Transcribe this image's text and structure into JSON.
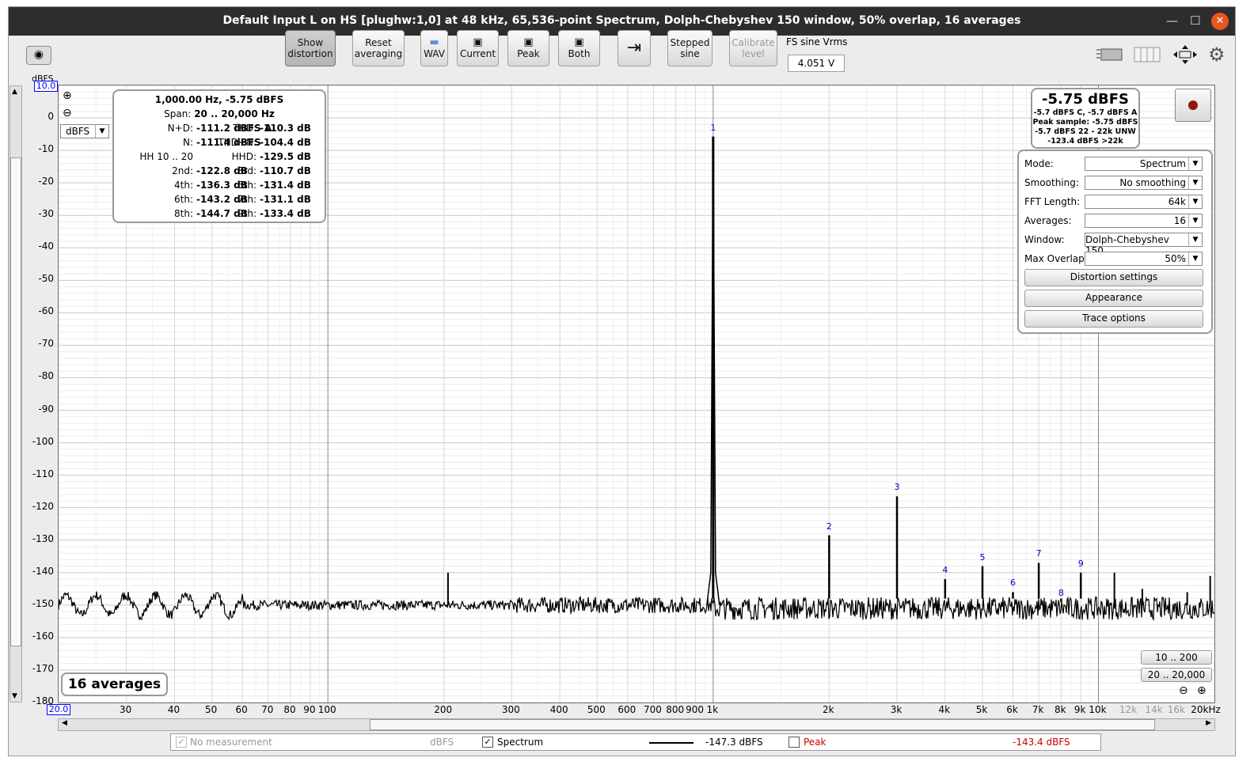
{
  "window": {
    "title": "Default Input L on HS [plughw:1,0] at 48 kHz, 65,536-point Spectrum, Dolph-Chebyshev 150 window, 50% overlap, 16 averages"
  },
  "toolbar": {
    "show_distortion": [
      "Show",
      "distortion"
    ],
    "reset_averaging": [
      "Reset",
      "averaging"
    ],
    "wav": "WAV",
    "current": "Current",
    "peak": "Peak",
    "both": "Both",
    "stepped_sine": [
      "Stepped",
      "sine"
    ],
    "calibrate_level": [
      "Calibrate",
      "level"
    ],
    "fs_label": "FS sine Vrms",
    "fs_value": "4.051 V"
  },
  "axis": {
    "unit": "dBFS",
    "ymax": "10.0",
    "xmin": "20.0",
    "y_ticks": [
      "0",
      "-10",
      "-20",
      "-30",
      "-40",
      "-50",
      "-60",
      "-70",
      "-80",
      "-90",
      "-100",
      "-110",
      "-120",
      "-130",
      "-140",
      "-150",
      "-160",
      "-170",
      "-180"
    ],
    "x_ticks": [
      "30",
      "40",
      "50",
      "60",
      "70",
      "80",
      "90",
      "100",
      "200",
      "300",
      "400",
      "500",
      "600",
      "700",
      "800",
      "900",
      "1k",
      "2k",
      "3k",
      "4k",
      "5k",
      "6k",
      "7k",
      "8k",
      "9k",
      "10k",
      "12k",
      "14k",
      "16k",
      "20kHz"
    ]
  },
  "unit_select": "dBFS",
  "distortion_panel": {
    "header": "1,000.00 Hz, -5.75 dBFS",
    "span_label": "Span:",
    "span_value": "20 .. 20,000 Hz",
    "rows": [
      {
        "l": "N+D:",
        "lv": "-111.2 dBFS A",
        "r": "THD:",
        "rv": "-110.3 dB"
      },
      {
        "l": "N:",
        "lv": "-111.4 dBFS",
        "r": "THD+N:",
        "rv": "-104.4 dB"
      },
      {
        "l": "HH 10 .. 20",
        "lv": "",
        "r": "HHD:",
        "rv": "-129.5 dB"
      },
      {
        "l": "2nd:",
        "lv": "-122.8 dB",
        "r": "3rd:",
        "rv": "-110.7 dB"
      },
      {
        "l": "4th:",
        "lv": "-136.3 dB",
        "r": "5th:",
        "rv": "-131.4 dB"
      },
      {
        "l": "6th:",
        "lv": "-143.2 dB",
        "r": "7th:",
        "rv": "-131.1 dB"
      },
      {
        "l": "8th:",
        "lv": "-144.7 dB",
        "r": "9th:",
        "rv": "-133.4 dB"
      }
    ]
  },
  "level_panel": {
    "big": "-5.75 dBFS",
    "lines": [
      "-5.7 dBFS C, -5.7 dBFS A",
      "Peak sample: -5.75 dBFS",
      "-5.7 dBFS 22 - 22k UNW",
      "-123.4 dBFS >22k"
    ]
  },
  "settings": {
    "rows": [
      {
        "label": "Mode:",
        "value": "Spectrum"
      },
      {
        "label": "Smoothing:",
        "value": "No  smoothing"
      },
      {
        "label": "FFT Length:",
        "value": "64k"
      },
      {
        "label": "Averages:",
        "value": "16"
      },
      {
        "label": "Window:",
        "value": "Dolph-Chebyshev 150"
      },
      {
        "label": "Max Overlap:",
        "value": "50%"
      }
    ],
    "buttons": [
      "Distortion settings",
      "Appearance",
      "Trace options"
    ]
  },
  "harmonics": [
    {
      "n": "1",
      "freq": 1000,
      "level": -5.75
    },
    {
      "n": "2",
      "freq": 2000,
      "level": -128.5
    },
    {
      "n": "3",
      "freq": 3000,
      "level": -116.5
    },
    {
      "n": "4",
      "freq": 4000,
      "level": -142
    },
    {
      "n": "5",
      "freq": 5000,
      "level": -138
    },
    {
      "n": "6",
      "freq": 6000,
      "level": -146
    },
    {
      "n": "7",
      "freq": 7000,
      "level": -137
    },
    {
      "n": "8",
      "freq": 8000,
      "level": -149
    },
    {
      "n": "9",
      "freq": 9000,
      "level": -140
    }
  ],
  "chart_data": {
    "type": "line",
    "x_scale": "log",
    "xlim": [
      20,
      20000
    ],
    "ylim": [
      -180,
      10
    ],
    "ylabel": "dBFS",
    "noise_floor_db": -150,
    "spur_peaks": [
      {
        "x": 205,
        "y": -140
      },
      {
        "x": 11000,
        "y": -140
      },
      {
        "x": 13000,
        "y": -145
      },
      {
        "x": 17000,
        "y": -146
      },
      {
        "x": 19500,
        "y": -141
      }
    ]
  },
  "range_buttons": [
    "10 .. 200",
    "20 .. 20,000"
  ],
  "averages_badge": "16 averages",
  "status": {
    "no_measurement": "No measurement",
    "no_meas_unit": "dBFS",
    "spectrum": "Spectrum",
    "spectrum_value": "-147.3 dBFS",
    "peak": "Peak",
    "peak_value": "-143.4 dBFS"
  }
}
